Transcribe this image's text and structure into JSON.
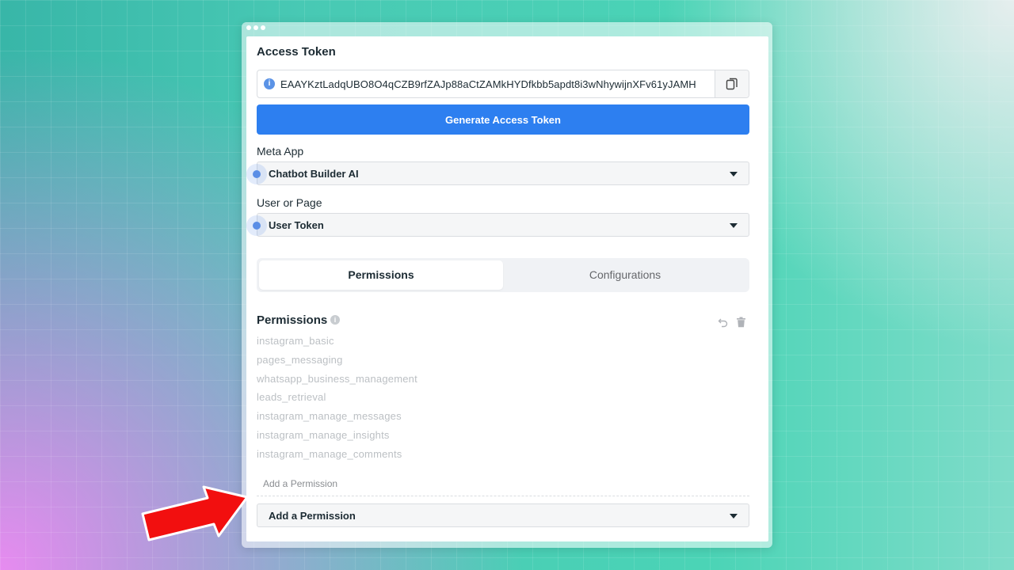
{
  "access_token": {
    "title": "Access Token",
    "value": "EAAYKztLadqUBO8O4qCZB9rfZAJp88aCtZAMkHYDfkbb5apdt8i3wNhywijnXFv61yJAMH",
    "generate_label": "Generate Access Token"
  },
  "meta_app": {
    "label": "Meta App",
    "selected": "Chatbot Builder AI"
  },
  "user_or_page": {
    "label": "User or Page",
    "selected": "User Token"
  },
  "tabs": [
    {
      "label": "Permissions",
      "active": true
    },
    {
      "label": "Configurations",
      "active": false
    }
  ],
  "permissions": {
    "title": "Permissions",
    "items": [
      "instagram_basic",
      "pages_messaging",
      "whatsapp_business_management",
      "leads_retrieval",
      "instagram_manage_messages",
      "instagram_manage_insights",
      "instagram_manage_comments"
    ],
    "add_placeholder": "Add a Permission",
    "add_select_label": "Add a Permission"
  },
  "icons": {
    "info": "info-icon",
    "copy": "copy-icon",
    "undo": "undo-icon",
    "trash": "trash-icon",
    "caret": "caret-down-icon",
    "arrow": "arrow-right-icon"
  },
  "colors": {
    "primary": "#2d7ff0",
    "arrow": "#f20f0f"
  }
}
